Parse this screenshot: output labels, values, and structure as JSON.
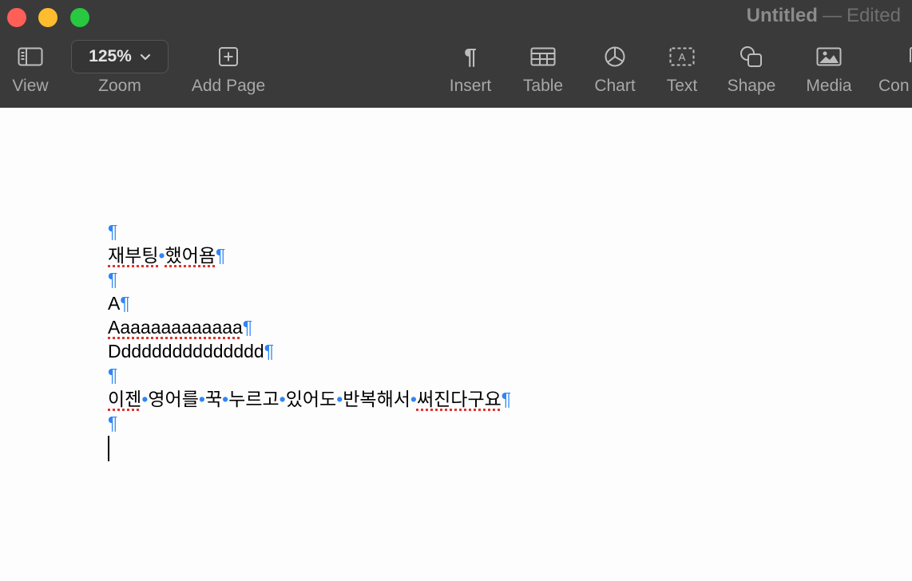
{
  "window": {
    "title": "Untitled",
    "separator": "—",
    "status": "Edited"
  },
  "toolbar": {
    "view": {
      "label": "View",
      "icon": "sidebar-icon"
    },
    "zoom": {
      "label": "Zoom",
      "value": "125%",
      "icon": "chevron-down-icon"
    },
    "add_page": {
      "label": "Add Page",
      "icon": "plus-square-icon"
    },
    "insert": {
      "label": "Insert",
      "icon": "pilcrow-icon",
      "glyph": "¶"
    },
    "table": {
      "label": "Table",
      "icon": "table-icon"
    },
    "chart": {
      "label": "Chart",
      "icon": "pie-chart-icon"
    },
    "text": {
      "label": "Text",
      "icon": "text-box-icon",
      "glyph": "A"
    },
    "shape": {
      "label": "Shape",
      "icon": "shape-icon"
    },
    "media": {
      "label": "Media",
      "icon": "photo-icon"
    },
    "comment": {
      "label": "Con"
    }
  },
  "document": {
    "pilcrow": "¶",
    "space_marker": "•",
    "lines": {
      "l2_w1": "재부팅",
      "l2_w2": "했어욤",
      "l4": "A",
      "l5": "Aaaaaaaaaaaaa",
      "l6": "Ddddddddddddddd",
      "l8_w1": "이젠",
      "l8_w2": "영어를",
      "l8_w3": "꾹",
      "l8_w4": "누르고",
      "l8_w5": "있어도",
      "l8_w6": "반복해서",
      "l8_w7": "써진다구요"
    }
  },
  "colors": {
    "toolbar_bg": "#3a3a3a",
    "invisibles": "#2f86f6",
    "spellcheck": "#e0342f"
  }
}
